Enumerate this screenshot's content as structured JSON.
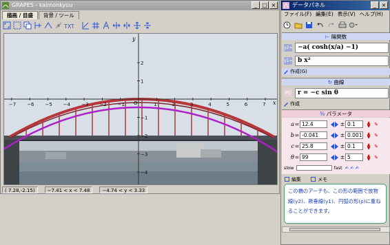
{
  "graph_window": {
    "title": "GRAPES - kaimonkyou",
    "tabs": [
      "描画 / 目盛",
      "背景 / ツール"
    ],
    "toolbar_icons": [
      "zoom-fit-icon",
      "zoom-region-icon",
      "copy-icon",
      "ruler-icon",
      "trace-icon",
      "marker-icon",
      "text-icon",
      "axis-line-icon",
      "grid-icon",
      "letter-a-icon",
      "widen-x-icon",
      "narrow-x-icon",
      "widen-y-icon",
      "narrow-y-icon"
    ],
    "statusbar": {
      "cursor": "( 7.28,-2.15)",
      "x_range": "−7.41 < x < 7.48",
      "y_range": "−4.74 < y < 3.33"
    }
  },
  "plot": {
    "axis_x_label": "x",
    "axis_y_label": "y",
    "origin_label": "O",
    "x_ticks": [
      -7,
      -6,
      -5,
      -4,
      -3,
      -2,
      -1,
      1,
      2,
      3,
      4,
      5,
      6,
      7
    ],
    "y_ticks": [
      2,
      1,
      -1,
      -2,
      -3,
      -4
    ],
    "curve_color": "#b020c8",
    "sky_color": "#d8dfe6",
    "water_color": "#7e8d96"
  },
  "data_panel": {
    "title": "データパネル",
    "menu": [
      "ファイル(F)",
      "編集(E)",
      "表示(V)",
      "ヘルプ(H)"
    ],
    "toolbar_icons": [
      "clock-icon",
      "open-folder-icon",
      "save-icon",
      "undo-icon",
      "redo-icon",
      "print-icon",
      "settings-icon"
    ],
    "functions_header": "陽関数",
    "functions": [
      {
        "badge": "y2=",
        "expr": "−a( cosh(x/a) −1)"
      },
      {
        "badge": "y1=",
        "expr": "b x²"
      }
    ],
    "action_label": "作成(G)",
    "curve_header": "曲線",
    "curve": {
      "badge": "P1",
      "expr": "r = −c sin θ"
    },
    "curve_action": "作成",
    "params_header": "パラメータ",
    "params": [
      {
        "name": "a",
        "value": "12.4",
        "step": "0.1"
      },
      {
        "name": "b",
        "value": "-0.041",
        "step": "0.001"
      },
      {
        "name": "c",
        "value": "25.8",
        "step": "0.1"
      },
      {
        "name": "θ",
        "value": "99",
        "step": "5"
      }
    ],
    "speed": {
      "slow": "slow",
      "fast": "fast"
    },
    "memo_tabs": [
      "編集",
      "メモ"
    ],
    "memo_text": "この橋のアーチも、この形の範囲で放物線(y2)、懸垂線(y1)、円弧の形(p)に重ねることができます。"
  }
}
